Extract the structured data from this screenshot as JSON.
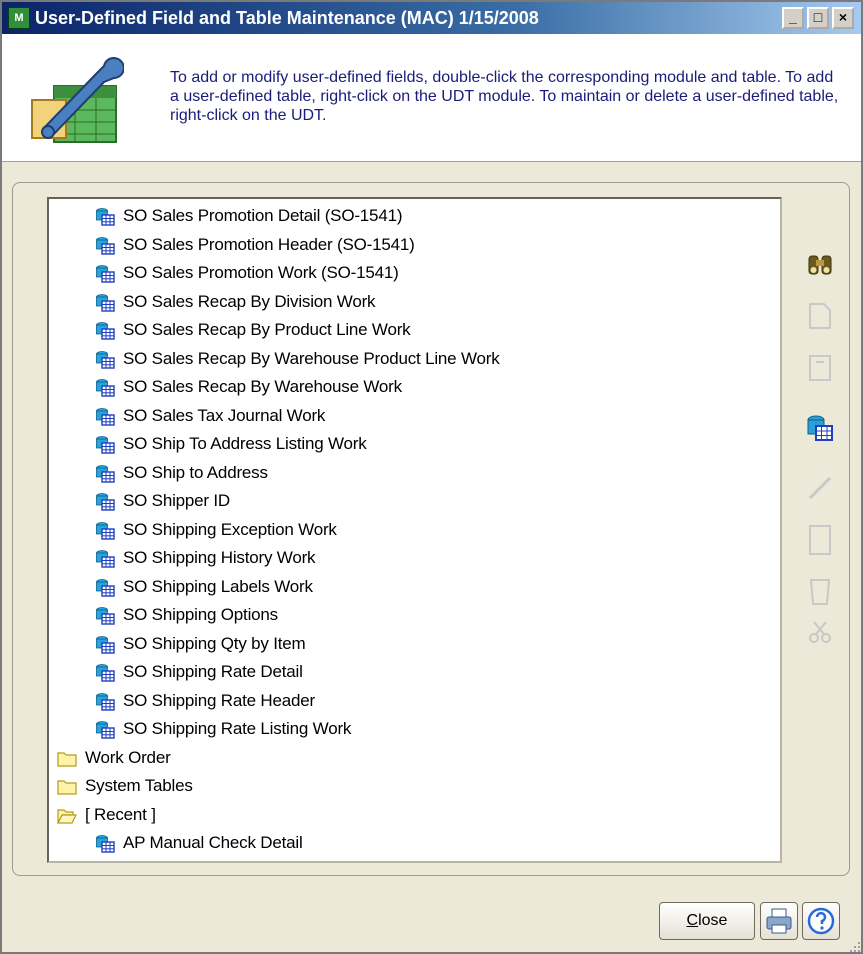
{
  "window": {
    "title": "User-Defined Field and Table Maintenance (MAC) 1/15/2008",
    "app_icon_text": "M",
    "minimize_label": "_",
    "maximize_label": "□",
    "close_label": "×"
  },
  "banner": {
    "description": "To add or modify user-defined fields, double-click the corresponding module and table.  To add a user-defined table, right-click on the UDT module.  To maintain or delete a user-defined table, right-click on the UDT.",
    "icon": "wrench-table-icon"
  },
  "tree": {
    "items": [
      {
        "label": "SO Sales Promotion Detail (SO-1541)",
        "icon": "table-icon",
        "level": 1
      },
      {
        "label": "SO Sales Promotion Header (SO-1541)",
        "icon": "table-icon",
        "level": 1
      },
      {
        "label": "SO Sales Promotion Work (SO-1541)",
        "icon": "table-icon",
        "level": 1
      },
      {
        "label": "SO Sales Recap By Division Work",
        "icon": "table-icon",
        "level": 1
      },
      {
        "label": "SO Sales Recap By Product Line Work",
        "icon": "table-icon",
        "level": 1
      },
      {
        "label": "SO Sales Recap By Warehouse Product Line Work",
        "icon": "table-icon",
        "level": 1
      },
      {
        "label": "SO Sales Recap By Warehouse Work",
        "icon": "table-icon",
        "level": 1
      },
      {
        "label": "SO Sales Tax Journal Work",
        "icon": "table-icon",
        "level": 1
      },
      {
        "label": "SO Ship To Address Listing Work",
        "icon": "table-icon",
        "level": 1
      },
      {
        "label": "SO Ship to Address",
        "icon": "table-icon",
        "level": 1
      },
      {
        "label": "SO Shipper ID",
        "icon": "table-icon",
        "level": 1
      },
      {
        "label": "SO Shipping Exception Work",
        "icon": "table-icon",
        "level": 1
      },
      {
        "label": "SO Shipping History Work",
        "icon": "table-icon",
        "level": 1
      },
      {
        "label": "SO Shipping Labels Work",
        "icon": "table-icon",
        "level": 1
      },
      {
        "label": "SO Shipping Options",
        "icon": "table-icon",
        "level": 1
      },
      {
        "label": "SO Shipping Qty by Item",
        "icon": "table-icon",
        "level": 1
      },
      {
        "label": "SO Shipping Rate Detail",
        "icon": "table-icon",
        "level": 1
      },
      {
        "label": "SO Shipping Rate Header",
        "icon": "table-icon",
        "level": 1
      },
      {
        "label": "SO Shipping Rate Listing Work",
        "icon": "table-icon",
        "level": 1
      },
      {
        "label": "Work Order",
        "icon": "folder-icon",
        "level": 0
      },
      {
        "label": "System Tables",
        "icon": "folder-icon",
        "level": 0
      },
      {
        "label": "[ Recent ]",
        "icon": "folder-open-icon",
        "level": 0
      },
      {
        "label": "AP Manual Check Detail",
        "icon": "table-icon",
        "level": 1
      }
    ]
  },
  "scrollbar": {
    "up_glyph": "▲",
    "down_glyph": "▼"
  },
  "side_toolbar": [
    {
      "name": "binoculars-icon",
      "enabled": true
    },
    {
      "name": "new-document-icon",
      "enabled": false
    },
    {
      "name": "edit-document-icon",
      "enabled": false
    },
    {
      "name": "table-icon",
      "enabled": true
    },
    {
      "name": "pencil-icon",
      "enabled": false
    },
    {
      "name": "blank-page-icon",
      "enabled": false
    },
    {
      "name": "trash-icon",
      "enabled": false
    },
    {
      "name": "scissors-icon",
      "enabled": false
    }
  ],
  "footer": {
    "close_label_u": "C",
    "close_label_rest": "lose",
    "print_icon": "printer-icon",
    "help_icon": "help-icon"
  },
  "colors": {
    "title_start": "#0a246a",
    "title_end": "#a6caf0",
    "banner_text": "#1b1b7a",
    "face": "#ece9d8"
  }
}
